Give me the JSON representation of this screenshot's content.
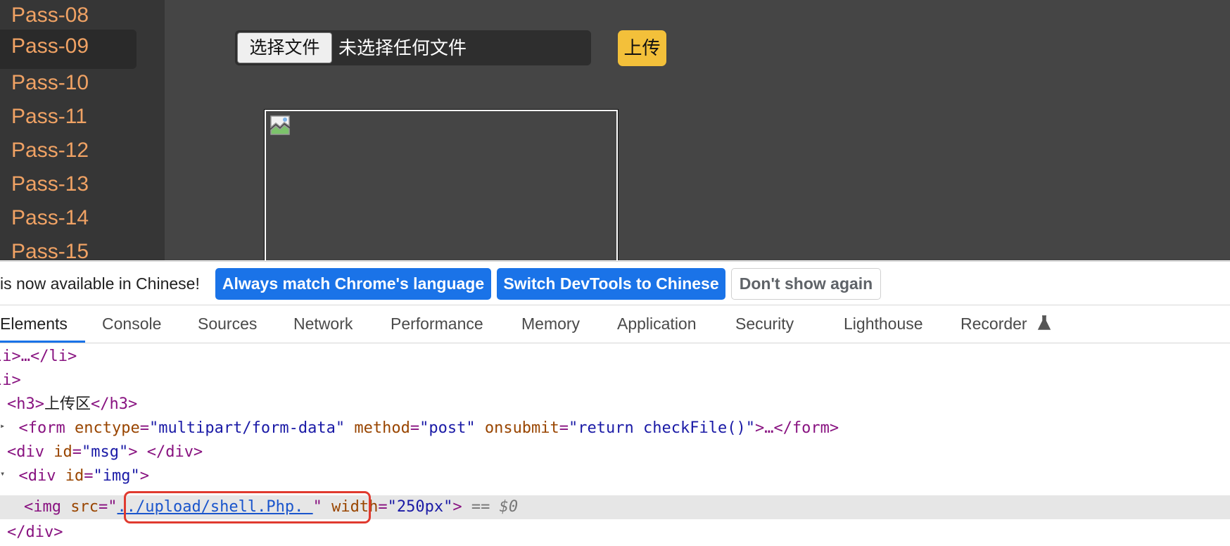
{
  "sidebar": {
    "items": [
      "Pass-08",
      "Pass-09",
      "Pass-10",
      "Pass-11",
      "Pass-12",
      "Pass-13",
      "Pass-14",
      "Pass-15"
    ],
    "active": "Pass-09"
  },
  "upload": {
    "choose_label": "选择文件",
    "status": "未选择任何文件",
    "upload_label": "上传"
  },
  "image": {
    "icon": "broken-image-icon"
  },
  "devtools": {
    "lang_bar": {
      "message": "is now available in Chinese!",
      "always_match": "Always match Chrome's language",
      "switch": "Switch DevTools to Chinese",
      "dont_show": "Don't show again"
    },
    "tabs": [
      "Elements",
      "Console",
      "Sources",
      "Network",
      "Performance",
      "Memory",
      "Application",
      "Security",
      "Lighthouse",
      "Recorder"
    ],
    "active_tab": "Elements",
    "code": {
      "l1": "li>…</li>",
      "l2": "li>",
      "l3_h3_open": "<h3>",
      "l3_text": "上传区",
      "l3_h3_close": "</h3>",
      "l4_form_open": "<form",
      "l4_enctype": "enctype",
      "l4_enctype_val": "\"multipart/form-data\"",
      "l4_method": "method",
      "l4_method_val": "\"post\"",
      "l4_onsubmit": "onsubmit",
      "l4_onsubmit_val": "\"return checkFile()\"",
      "l4_rest": ">…</form>",
      "l5_div": "<div",
      "l5_id": "id",
      "l5_id_val": "\"msg\"",
      "l5_rest": "> </div>",
      "l6_div": "<div",
      "l6_id": "id",
      "l6_id_val": "\"img\"",
      "l6_rest": ">",
      "l7_img": "<img",
      "l7_src": "src",
      "l7_src_val": "../upload/shell.Php. ",
      "l7_width": "width",
      "l7_width_val": "\"250px\"",
      "l7_close": ">",
      "l7_eq": "== ",
      "l7_dollar": "$0",
      "l8": "</div>"
    }
  },
  "colors": {
    "page_bg": "#454545",
    "sidebar_link": "#f0a264",
    "upload_button": "#f3c03a",
    "devtools_blue": "#1a73e8",
    "highlight": "#e03a2f"
  }
}
